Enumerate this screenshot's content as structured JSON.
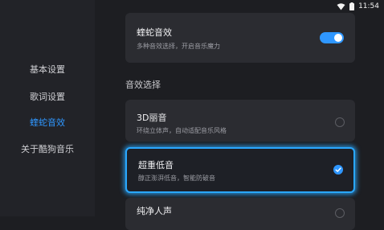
{
  "status_bar": {
    "time": "11:54",
    "wifi_icon": "wifi-icon",
    "battery_icon": "battery-icon"
  },
  "sidebar": {
    "items": [
      {
        "label": "基本设置",
        "active": false
      },
      {
        "label": "歌词设置",
        "active": false
      },
      {
        "label": "蝰蛇音效",
        "active": true
      },
      {
        "label": "关于酷狗音乐",
        "active": false
      }
    ]
  },
  "viper_card": {
    "title": "蝰蛇音效",
    "subtitle": "多种音效选择，开启音乐魔力",
    "toggle_on": true
  },
  "section": {
    "title": "音效选择"
  },
  "options": [
    {
      "title": "3D丽音",
      "subtitle": "环绕立体声，自动适配音乐风格",
      "selected": false
    },
    {
      "title": "超重低音",
      "subtitle": "醇正澎湃低音，智能防破音",
      "selected": true
    },
    {
      "title": "纯净人声",
      "subtitle": "",
      "selected": false
    }
  ],
  "colors": {
    "accent": "#2f97ff",
    "background": "#1d1e22",
    "card": "#2b2c31"
  }
}
